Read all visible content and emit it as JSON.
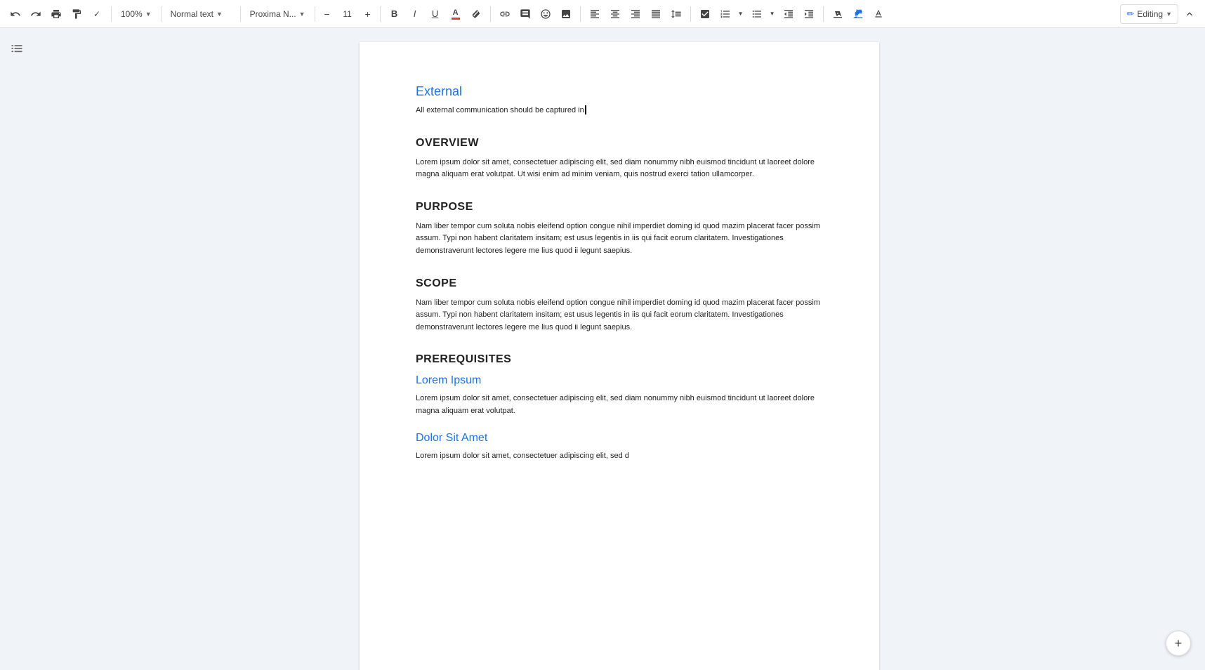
{
  "toolbar": {
    "zoom": "100%",
    "text_style": "Normal text",
    "font_family": "Proxima N...",
    "font_size": "11",
    "editing_mode": "Editing",
    "undo_label": "Undo",
    "redo_label": "Redo",
    "print_label": "Print",
    "paint_format_label": "Paint format",
    "bold_label": "B",
    "italic_label": "I",
    "underline_label": "U",
    "text_color_label": "A",
    "highlight_label": "✏",
    "link_label": "🔗",
    "comment_label": "💬",
    "emoji_label": "☺",
    "image_label": "🖼",
    "align_left_label": "≡",
    "align_center_label": "≡",
    "align_right_label": "≡",
    "align_justify_label": "≡",
    "line_spacing_label": "↕",
    "checklist_label": "☑",
    "numbered_list_label": "1.",
    "bullet_list_label": "•",
    "decrease_indent_label": "←",
    "increase_indent_label": "→",
    "clear_format_label": "T",
    "text_mode_label": "T",
    "minus_label": "−",
    "plus_label": "+"
  },
  "document": {
    "section_external": {
      "heading": "External",
      "body": "All external communication should be captured in"
    },
    "section_overview": {
      "heading": "OVERVIEW",
      "body": "Lorem ipsum dolor sit amet, consectetuer adipiscing elit, sed diam nonummy nibh euismod tincidunt ut laoreet dolore magna aliquam erat volutpat. Ut wisi enim ad minim veniam, quis nostrud exerci tation ullamcorper."
    },
    "section_purpose": {
      "heading": "PURPOSE",
      "body": "Nam liber tempor cum soluta nobis eleifend option congue nihil imperdiet doming id quod mazim placerat facer possim assum. Typi non habent claritatem insitam; est usus legentis in iis qui facit eorum claritatem. Investigationes demonstraverunt lectores legere me lius quod ii legunt saepius."
    },
    "section_scope": {
      "heading": "SCOPE",
      "body": "Nam liber tempor cum soluta nobis eleifend option congue nihil imperdiet doming id quod mazim placerat facer possim assum. Typi non habent claritatem insitam; est usus legentis in iis qui facit eorum claritatem. Investigationes demonstraverunt lectores legere me lius quod ii legunt saepius."
    },
    "section_prerequisites": {
      "heading": "PREREQUISITES",
      "subsection1_heading": "Lorem Ipsum",
      "subsection1_body": "Lorem ipsum dolor sit amet, consectetuer adipiscing elit, sed diam nonummy nibh euismod tincidunt ut laoreet dolore magna aliquam erat volutpat.",
      "subsection2_heading": "Dolor Sit Amet",
      "subsection2_body": "Lorem ipsum dolor sit amet, consectetuer adipiscing elit, sed d"
    }
  },
  "sidebar": {
    "outline_icon": "☰"
  },
  "fab": {
    "label": "+"
  }
}
